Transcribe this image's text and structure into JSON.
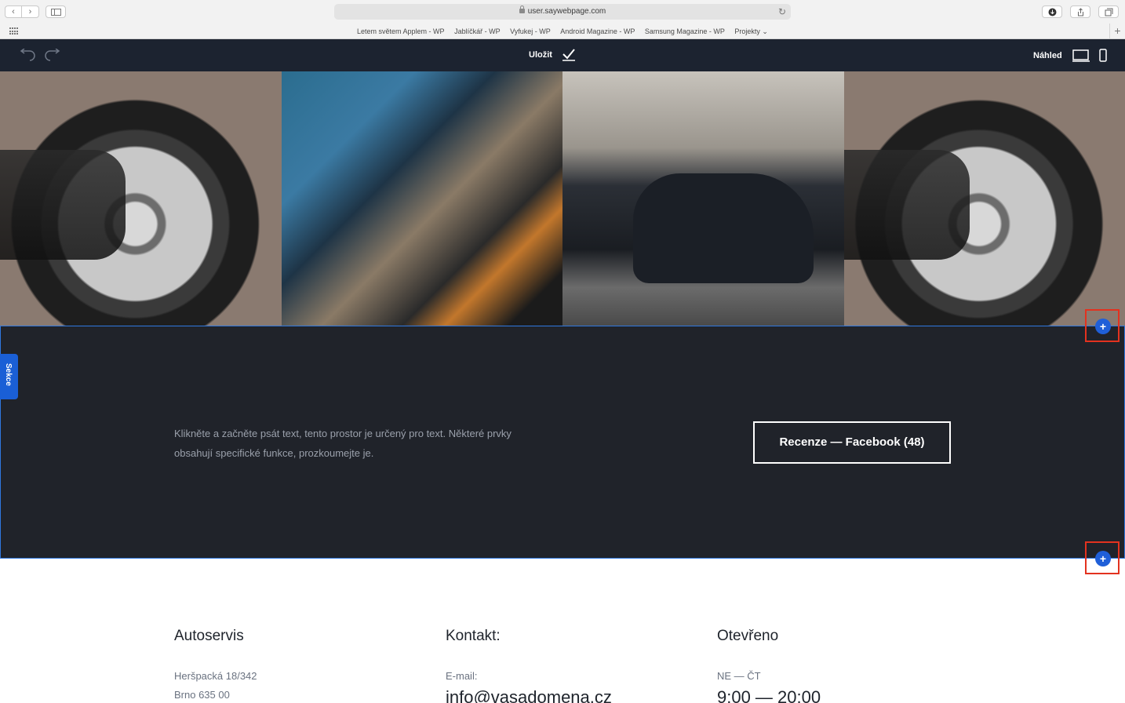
{
  "browser": {
    "url": "user.saywebpage.com",
    "bookmarks": [
      "Letem světem Applem - WP",
      "Jablíčkář - WP",
      "Vyfukej - WP",
      "Android Magazine - WP",
      "Samsung Magazine - WP",
      "Projekty ⌄"
    ]
  },
  "editor": {
    "save_label": "Uložit",
    "preview_label": "Náhled"
  },
  "photos": [
    "wheel-impact-wrench",
    "mechanic-engine",
    "garage-car",
    "wheel-impact-wrench"
  ],
  "section": {
    "tab_label": "Sekce",
    "text": "Klikněte a začněte psát text, tento prostor je určený pro text. Některé prvky obsahují specifické funkce, prozkoumejte je.",
    "button_label": "Recenze — Facebook (48)",
    "add_symbol": "+"
  },
  "footer": {
    "col1": {
      "title": "Autoservis",
      "line1": "Heršpacká 18/342",
      "line2": "Brno 635 00"
    },
    "col2": {
      "title": "Kontakt:",
      "line1": "E-mail:",
      "line2": "info@vasadomena.cz"
    },
    "col3": {
      "title": "Otevřeno",
      "line1": "NE — ČT",
      "line2": "9:00 — 20:00"
    }
  },
  "colors": {
    "editor_bar": "#1c2330",
    "section_bg": "#20232a",
    "accent_blue": "#1f5fd8",
    "highlight_red": "#e3321f"
  }
}
